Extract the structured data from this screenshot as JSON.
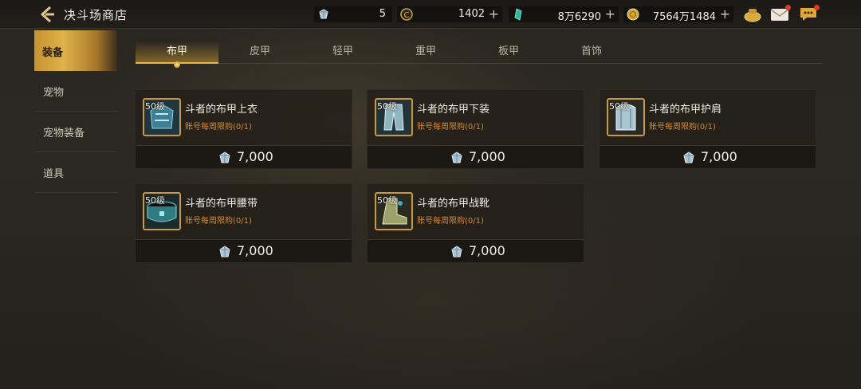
{
  "header": {
    "title": "决斗场商店"
  },
  "currencies": [
    {
      "value": "5",
      "has_plus": false,
      "icon": "gem-currency-icon"
    },
    {
      "value": "1402",
      "has_plus": true,
      "icon": "coin-c-icon"
    },
    {
      "value": "8万6290",
      "has_plus": true,
      "icon": "green-crystal-icon"
    },
    {
      "value": "7564万1484",
      "has_plus": true,
      "icon": "gold-coin-icon"
    }
  ],
  "sidebar": {
    "items": [
      {
        "label": "装备",
        "active": true
      },
      {
        "label": "宠物",
        "active": false
      },
      {
        "label": "宠物装备",
        "active": false
      },
      {
        "label": "道具",
        "active": false
      }
    ]
  },
  "tabs": [
    {
      "label": "布甲",
      "active": true
    },
    {
      "label": "皮甲",
      "active": false
    },
    {
      "label": "轻甲",
      "active": false
    },
    {
      "label": "重甲",
      "active": false
    },
    {
      "label": "板甲",
      "active": false
    },
    {
      "label": "首饰",
      "active": false
    }
  ],
  "items": [
    {
      "level": "50级",
      "name": "斗者的布甲上衣",
      "limit": "账号每周限购(0/1)",
      "price": "7,000"
    },
    {
      "level": "50级",
      "name": "斗者的布甲下装",
      "limit": "账号每周限购(0/1)",
      "price": "7,000"
    },
    {
      "level": "50级",
      "name": "斗者的布甲护肩",
      "limit": "账号每周限购(0/1)",
      "price": "7,000"
    },
    {
      "level": "50级",
      "name": "斗者的布甲腰带",
      "limit": "账号每周限购(0/1)",
      "price": "7,000"
    },
    {
      "level": "50级",
      "name": "斗者的布甲战靴",
      "limit": "账号每周限购(0/1)",
      "price": "7,000"
    }
  ],
  "colors": {
    "accent_gold": "#e0b24a",
    "limit_orange": "#d9892c",
    "alert_red": "#e03a2a"
  }
}
